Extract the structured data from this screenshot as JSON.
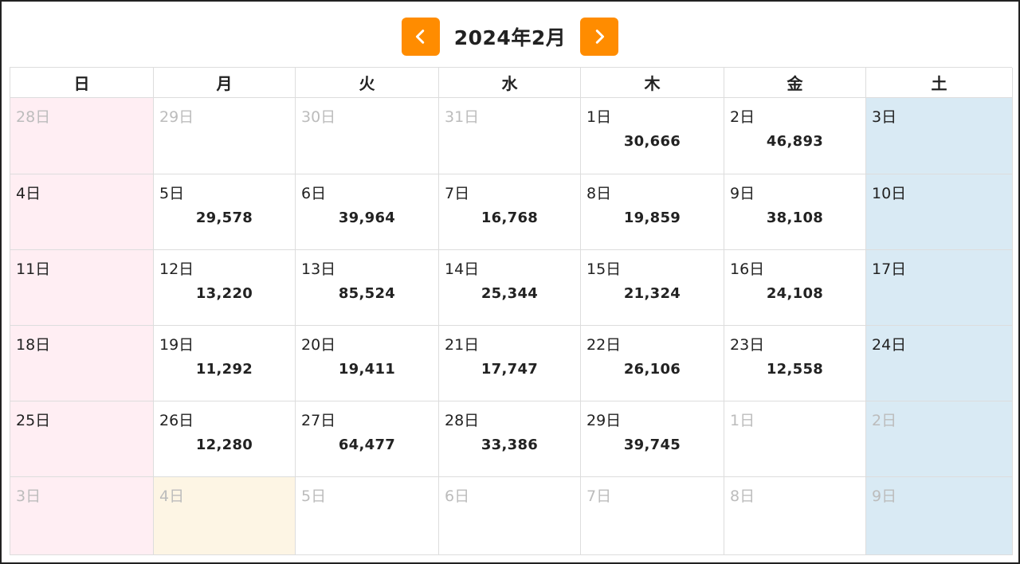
{
  "header": {
    "title": "2024年2月",
    "prev_icon": "chevron-left-icon",
    "next_icon": "chevron-right-icon"
  },
  "colors": {
    "accent": "#ff8c00",
    "sunday_bg": "#ffeef3",
    "saturday_bg": "#d9eaf4",
    "today_bg": "#fdf5e4",
    "muted_text": "#bcbcbc"
  },
  "weekdays": [
    "日",
    "月",
    "火",
    "水",
    "木",
    "金",
    "土"
  ],
  "weeks": [
    [
      {
        "label": "28日",
        "muted": true
      },
      {
        "label": "29日",
        "muted": true
      },
      {
        "label": "30日",
        "muted": true
      },
      {
        "label": "31日",
        "muted": true
      },
      {
        "label": "1日",
        "count": "30,666"
      },
      {
        "label": "2日",
        "count": "46,893"
      },
      {
        "label": "3日"
      }
    ],
    [
      {
        "label": "4日"
      },
      {
        "label": "5日",
        "count": "29,578"
      },
      {
        "label": "6日",
        "count": "39,964"
      },
      {
        "label": "7日",
        "count": "16,768"
      },
      {
        "label": "8日",
        "count": "19,859"
      },
      {
        "label": "9日",
        "count": "38,108"
      },
      {
        "label": "10日"
      }
    ],
    [
      {
        "label": "11日"
      },
      {
        "label": "12日",
        "count": "13,220"
      },
      {
        "label": "13日",
        "count": "85,524"
      },
      {
        "label": "14日",
        "count": "25,344"
      },
      {
        "label": "15日",
        "count": "21,324"
      },
      {
        "label": "16日",
        "count": "24,108"
      },
      {
        "label": "17日"
      }
    ],
    [
      {
        "label": "18日"
      },
      {
        "label": "19日",
        "count": "11,292"
      },
      {
        "label": "20日",
        "count": "19,411"
      },
      {
        "label": "21日",
        "count": "17,747"
      },
      {
        "label": "22日",
        "count": "26,106"
      },
      {
        "label": "23日",
        "count": "12,558"
      },
      {
        "label": "24日"
      }
    ],
    [
      {
        "label": "25日"
      },
      {
        "label": "26日",
        "count": "12,280"
      },
      {
        "label": "27日",
        "count": "64,477"
      },
      {
        "label": "28日",
        "count": "33,386"
      },
      {
        "label": "29日",
        "count": "39,745"
      },
      {
        "label": "1日",
        "muted": true
      },
      {
        "label": "2日",
        "muted": true
      }
    ],
    [
      {
        "label": "3日",
        "muted": true
      },
      {
        "label": "4日",
        "muted": true,
        "today": true
      },
      {
        "label": "5日",
        "muted": true
      },
      {
        "label": "6日",
        "muted": true
      },
      {
        "label": "7日",
        "muted": true
      },
      {
        "label": "8日",
        "muted": true
      },
      {
        "label": "9日",
        "muted": true
      }
    ]
  ]
}
